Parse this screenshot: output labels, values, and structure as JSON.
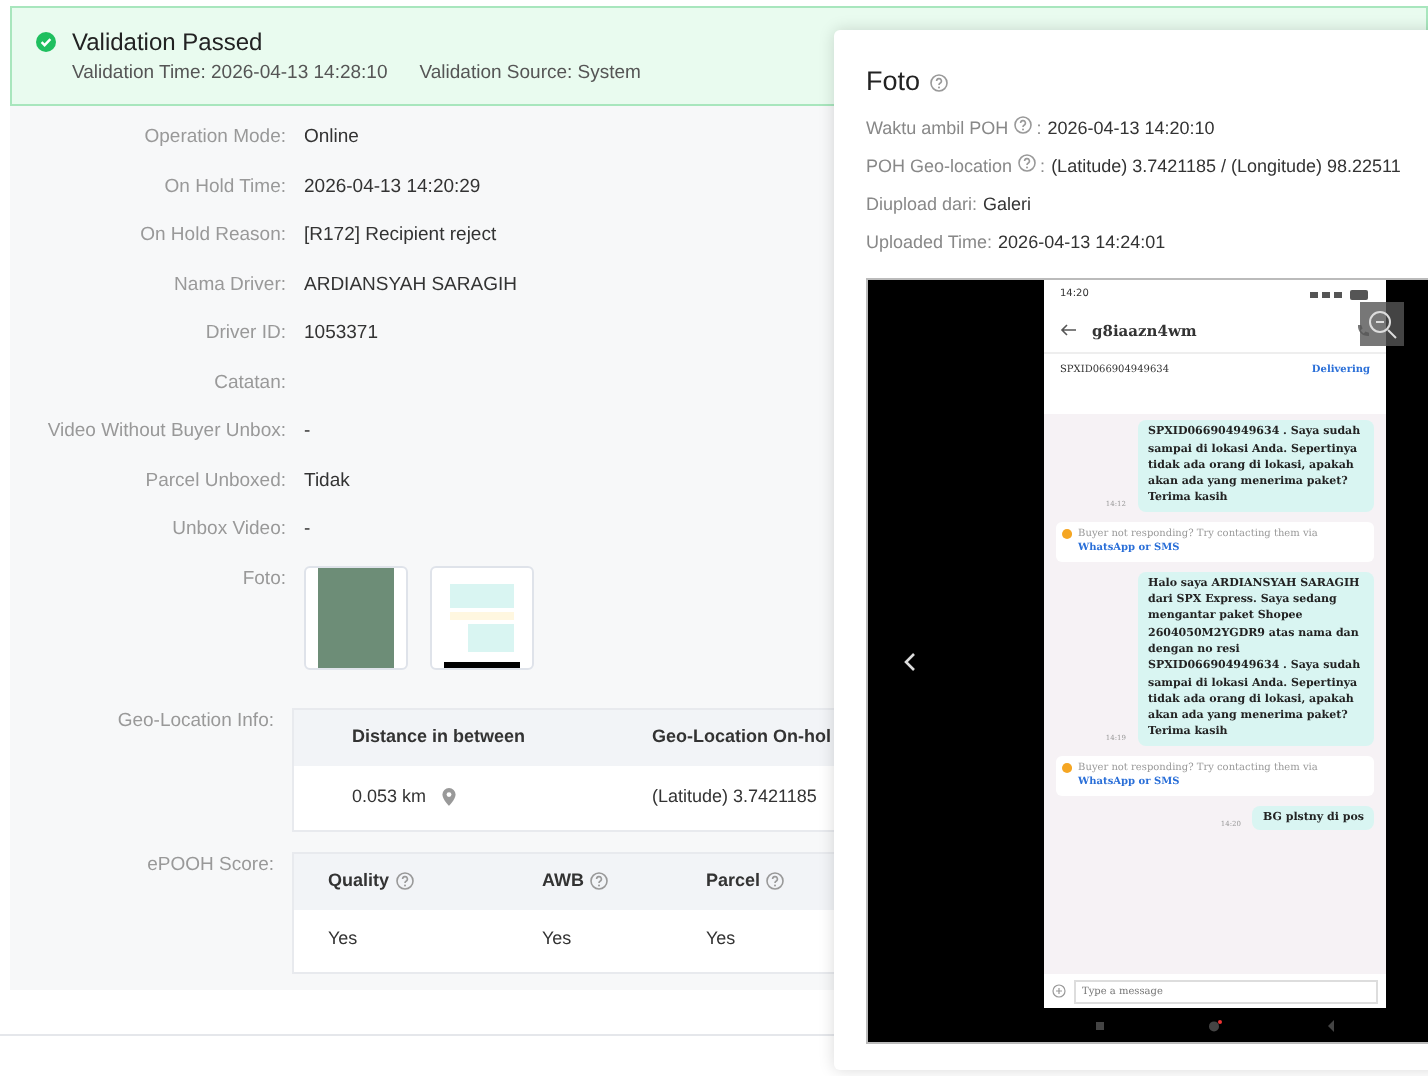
{
  "validation": {
    "passed": true,
    "title": "Validation Passed",
    "time": "Validation Time: 2026-04-13 14:28:10",
    "source": "Validation Source: System"
  },
  "details": [
    {
      "kind": "text",
      "label": "Operation Mode:",
      "value": "Online"
    },
    {
      "kind": "text",
      "label": "On Hold Time:",
      "value": "2026-04-13 14:20:29"
    },
    {
      "kind": "text",
      "label": "On Hold Reason:",
      "value": "[R172] Recipient reject"
    },
    {
      "kind": "text",
      "label": "Nama Driver:",
      "value": "ARDIANSYAH SARAGIH"
    },
    {
      "kind": "text",
      "label": "Driver ID:",
      "value": "1053371"
    },
    {
      "kind": "text",
      "label": "Catatan:"
    },
    {
      "kind": "text",
      "label": "Video Without Buyer Unbox:",
      "value": "-"
    },
    {
      "kind": "text",
      "label": "Parcel Unboxed:",
      "value": "Tidak"
    },
    {
      "kind": "text",
      "label": "Unbox Video:",
      "value": "-"
    },
    {
      "kind": "photos",
      "label": "Foto:",
      "photos": [
        {
          "kind": "photo"
        },
        {
          "kind": "screenshot"
        }
      ]
    }
  ],
  "geo_location": {
    "label": "Geo-Location Info:",
    "columns": [
      {
        "label": "Distance in between"
      },
      {
        "label": "Geo-Location On-hol"
      }
    ],
    "rows": [
      {
        "cells": [
          {
            "text": "0.053 km",
            "pin": true
          },
          {
            "text": "(Latitude) 3.7421185"
          }
        ]
      }
    ]
  },
  "epooh": {
    "label": "ePOOH Score:",
    "columns": [
      {
        "label": "Quality",
        "help": true
      },
      {
        "label": "AWB",
        "help": true
      },
      {
        "label": "Parcel",
        "help": true
      }
    ],
    "rows": [
      [
        "Yes",
        "Yes",
        "Yes"
      ]
    ]
  },
  "photo_modal": {
    "title": "Foto",
    "title_help": true,
    "info": [
      {
        "label": "Waktu ambil POH",
        "help": true,
        "separator": ":",
        "value": "2026-04-13 14:20:10"
      },
      {
        "label": "POH Geo-location",
        "help": true,
        "separator": ":",
        "value": "(Latitude) 3.7421185 / (Longitude) 98.22511"
      },
      {
        "label": "Diupload dari:",
        "help": false,
        "value": "Galeri"
      },
      {
        "label": "Uploaded Time:",
        "help": false,
        "value": "2026-04-13 14:24:01"
      }
    ],
    "screenshot": {
      "status_time": "14:20",
      "contact": "g8iaazn4wm",
      "order_id": "SPXID066904949634",
      "order_status": "Delivering",
      "messages": [
        {
          "kind": "outgoing",
          "text": "SPXID066904949634 . Saya sudah sampai di lokasi Anda. Sepertinya tidak ada orang di lokasi, apakah akan ada yang menerima paket? Terima kasih",
          "time": "14:12"
        },
        {
          "kind": "notice",
          "text": "Buyer not responding? Try contacting them via ",
          "link": "WhatsApp or SMS"
        },
        {
          "kind": "outgoing",
          "text": "Halo saya ARDIANSYAH SARAGIH  dari SPX Express. Saya sedang mengantar paket Shopee 2604050M2YGDR9 atas nama dan dengan no resi SPXID066904949634 . Saya sudah sampai di lokasi Anda. Sepertinya tidak ada orang di lokasi, apakah akan ada yang menerima paket? Terima kasih",
          "time": "14:19"
        },
        {
          "kind": "notice",
          "text": "Buyer not responding? Try contacting them via ",
          "link": "WhatsApp or SMS"
        },
        {
          "kind": "outgoing",
          "text": "BG plstny di pos",
          "time": "14:20"
        }
      ],
      "input_placeholder": "Type a message"
    }
  }
}
